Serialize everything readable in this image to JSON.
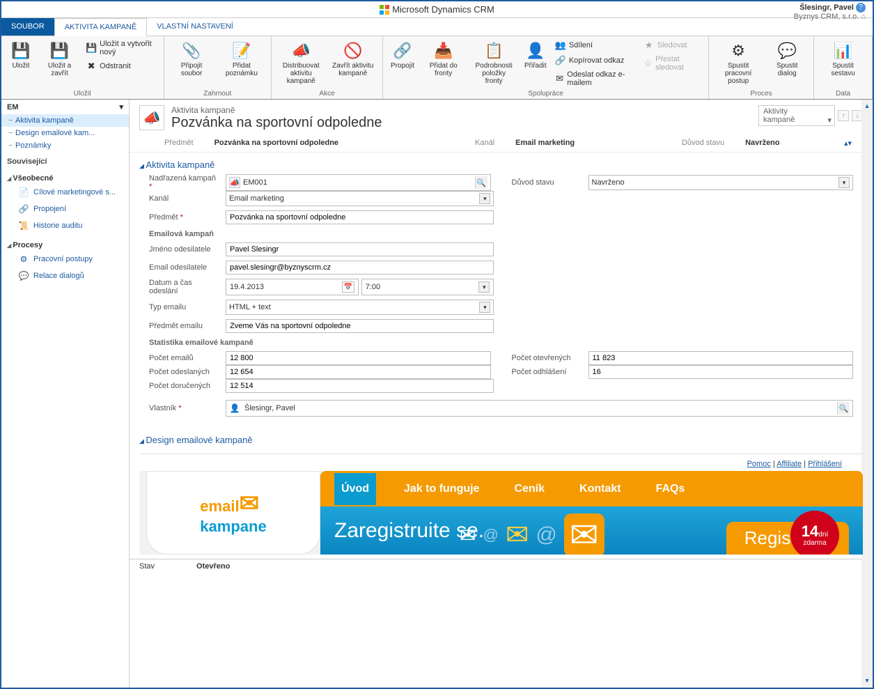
{
  "titlebar": {
    "app": "Microsoft Dynamics CRM",
    "user": "Šlesingr, Pavel",
    "org": "Byznys CRM, s.r.o."
  },
  "tabs": {
    "file": "SOUBOR",
    "active": "AKTIVITA KAMPANĚ",
    "custom": "VLASTNÍ NASTAVENÍ"
  },
  "ribbon": {
    "save": "Uložit",
    "saveClose": "Uložit a zavřít",
    "saveNew": "Uložit a vytvořit nový",
    "delete": "Odstranit",
    "saveGroup": "Uložit",
    "attach": "Připojit soubor",
    "addNote": "Přidat poznámku",
    "includeGroup": "Zahrnout",
    "distribute": "Distribuovat aktivitu kampaně",
    "closeAct": "Zavřít aktivitu kampaně",
    "actionsGroup": "Akce",
    "link": "Propojit",
    "addQueue": "Přidat do fronty",
    "queueDetail": "Podrobnosti položky fronty",
    "assign": "Přiřadit",
    "share": "Sdílení",
    "copyLink": "Kopírovat odkaz",
    "emailLink": "Odeslat odkaz e-mailem",
    "follow": "Sledovat",
    "unfollow": "Přestat sledovat",
    "collabGroup": "Spolupráce",
    "workflow": "Spustit pracovní postup",
    "dialog": "Spustit dialog",
    "processGroup": "Proces",
    "report": "Spustit sestavu",
    "dataGroup": "Data"
  },
  "leftnav": {
    "header": "EM",
    "items": [
      "Aktivita kampaně",
      "Design emailové kam...",
      "Poznámky"
    ],
    "related": "Související",
    "general": "Všeobecné",
    "generalItems": [
      "Cílové marketingové s...",
      "Propojení",
      "Historie auditu"
    ],
    "processes": "Procesy",
    "procItems": [
      "Pracovní postupy",
      "Relace dialogů"
    ]
  },
  "header": {
    "type": "Aktivita kampaně",
    "title": "Pozvánka na sportovní odpoledne",
    "selector": "Aktivity kampaně"
  },
  "summary": {
    "subjectLbl": "Předmět",
    "subject": "Pozvánka na sportovní odpoledne",
    "channelLbl": "Kanál",
    "channel": "Email marketing",
    "stateLbl": "Důvod stavu",
    "state": "Navrženo"
  },
  "sections": {
    "activity": "Aktivita kampaně",
    "design": "Design emailové kampaně"
  },
  "form": {
    "parentLbl": "Nadřazená kampaň",
    "parent": "EM001",
    "stateReasonLbl": "Důvod stavu",
    "stateReason": "Navrženo",
    "channelLbl": "Kanál",
    "channel": "Email marketing",
    "subjectLbl": "Předmět",
    "subject": "Pozvánka na sportovní odpoledne",
    "emailCampaign": "Emailová kampaň",
    "senderNameLbl": "Jméno odesilatele",
    "senderName": "Pavel Šlesingr",
    "senderEmailLbl": "Email odesilatele",
    "senderEmail": "pavel.slesingr@byznyscrm.cz",
    "sendDateLbl": "Datum a čas odeslání",
    "sendDate": "19.4.2013",
    "sendTime": "7:00",
    "emailTypeLbl": "Typ emailu",
    "emailType": "HTML + text",
    "emailSubjectLbl": "Předmět emailu",
    "emailSubject": "Zveme Vás na sportovní odpoledne",
    "stats": "Statistika emailové kampaně",
    "cntEmailsLbl": "Počet emailů",
    "cntEmails": "12 800",
    "cntSentLbl": "Počet odeslaných",
    "cntSent": "12 654",
    "cntDeliveredLbl": "Počet doručených",
    "cntDelivered": "12 514",
    "cntOpenedLbl": "Počet otevřených",
    "cntOpened": "11 823",
    "cntUnsubLbl": "Počet odhlášení",
    "cntUnsub": "16",
    "ownerLbl": "Vlastník",
    "owner": "Šlesingr, Pavel"
  },
  "preview": {
    "links": [
      "Pomoc",
      "Affiliate",
      "Přihlášení"
    ],
    "logo1": "email",
    "logo2": "kampane",
    "nav": [
      "Úvod",
      "Jak to funguje",
      "Ceník",
      "Kontakt",
      "FAQs"
    ],
    "heroTitle": "Zaregistruite se.",
    "reg": "Registrace",
    "badgeNum": "14",
    "badgeDni": "dní",
    "badgeFree": "zdarma"
  },
  "status": {
    "lbl": "Stav",
    "val": "Otevřeno"
  }
}
